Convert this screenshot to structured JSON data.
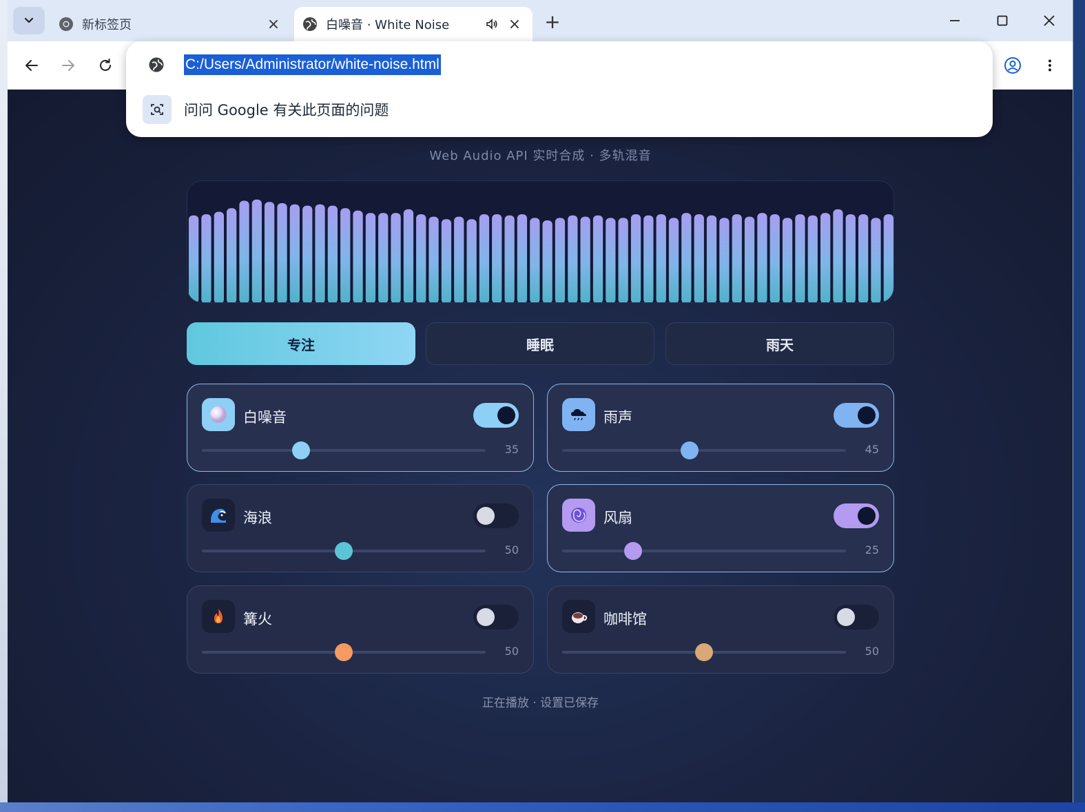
{
  "browser": {
    "tabs": [
      {
        "title": "新标签页",
        "active": false
      },
      {
        "title": "白噪音 · White Noise",
        "active": true
      }
    ],
    "url": "C:/Users/Administrator/white-noise.html",
    "suggestion": "问问 Google 有关此页面的问题"
  },
  "page": {
    "subtitle": "Web Audio API 实时合成 · 多轨混音",
    "presets": [
      {
        "label": "专注",
        "active": true
      },
      {
        "label": "睡眠",
        "active": false
      },
      {
        "label": "雨天",
        "active": false
      }
    ],
    "visualizer_levels": [
      0.72,
      0.73,
      0.75,
      0.78,
      0.84,
      0.85,
      0.83,
      0.82,
      0.81,
      0.8,
      0.81,
      0.8,
      0.78,
      0.76,
      0.74,
      0.74,
      0.74,
      0.77,
      0.73,
      0.71,
      0.69,
      0.71,
      0.69,
      0.73,
      0.73,
      0.72,
      0.73,
      0.7,
      0.68,
      0.7,
      0.72,
      0.71,
      0.72,
      0.7,
      0.7,
      0.73,
      0.72,
      0.73,
      0.7,
      0.74,
      0.73,
      0.72,
      0.7,
      0.73,
      0.71,
      0.74,
      0.73,
      0.7,
      0.73,
      0.72,
      0.74,
      0.77,
      0.73,
      0.73,
      0.7,
      0.73
    ],
    "sounds": [
      {
        "name": "白噪音",
        "icon": "pearl-icon",
        "on": true,
        "value": "35",
        "level": 0.35,
        "color": "#8ecff5",
        "icon_bg": "#8ecff5"
      },
      {
        "name": "雨声",
        "icon": "rain-cloud-icon",
        "on": true,
        "value": "45",
        "level": 0.45,
        "color": "#7fb3f2",
        "icon_bg": "#7fb3f2"
      },
      {
        "name": "海浪",
        "icon": "wave-icon",
        "on": false,
        "value": "50",
        "level": 0.5,
        "color": "#5cc4d6",
        "icon_bg": "#1a2038"
      },
      {
        "name": "风扇",
        "icon": "fan-icon",
        "on": true,
        "value": "25",
        "level": 0.25,
        "color": "#b49af0",
        "icon_bg": "#b49af0"
      },
      {
        "name": "篝火",
        "icon": "fire-icon",
        "on": false,
        "value": "50",
        "level": 0.5,
        "color": "#f49a62",
        "icon_bg": "#1a2038"
      },
      {
        "name": "咖啡馆",
        "icon": "coffee-icon",
        "on": false,
        "value": "50",
        "level": 0.5,
        "color": "#d9a877",
        "icon_bg": "#1a2038"
      }
    ],
    "status": "正在播放 · 设置已保存"
  }
}
